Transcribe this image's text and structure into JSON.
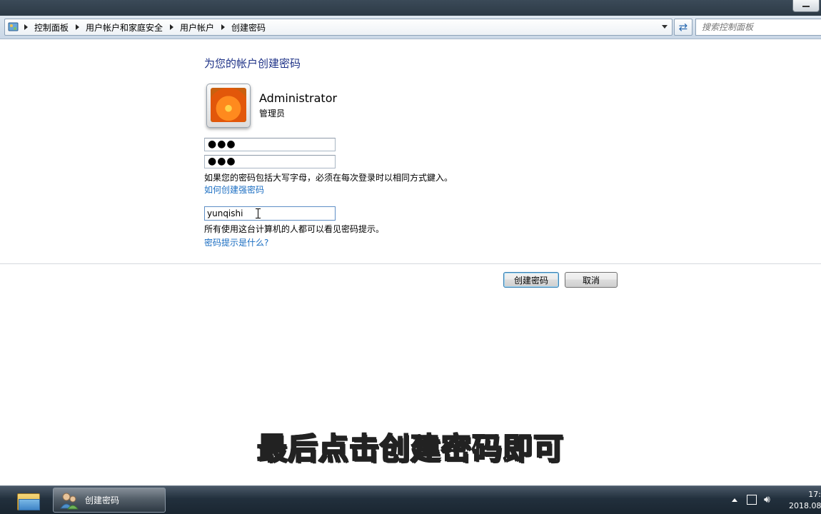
{
  "address_bar": {
    "breadcrumbs": [
      "控制面板",
      "用户帐户和家庭安全",
      "用户帐户",
      "创建密码"
    ],
    "search_placeholder": "搜索控制面板"
  },
  "page": {
    "title": "为您的帐户创建密码",
    "user": {
      "name": "Administrator",
      "role": "管理员"
    },
    "new_password_mask": "●●●",
    "confirm_password_mask": "●●●",
    "case_sensitivity_note": "如果您的密码包括大写字母，必须在每次登录时以相同方式鍵入。",
    "strong_password_link": "如何创建强密码",
    "password_hint_value": "yunqishi",
    "hint_visibility_note": "所有使用这台计算机的人都可以看见密码提示。",
    "hint_help_link": "密码提示是什么?"
  },
  "buttons": {
    "create": "创建密码",
    "cancel": "取消"
  },
  "subtitle_caption": "最后点击创建密码即可",
  "taskbar": {
    "active_window_label": "创建密码",
    "clock_time": "17:",
    "clock_date": "2018.08"
  }
}
